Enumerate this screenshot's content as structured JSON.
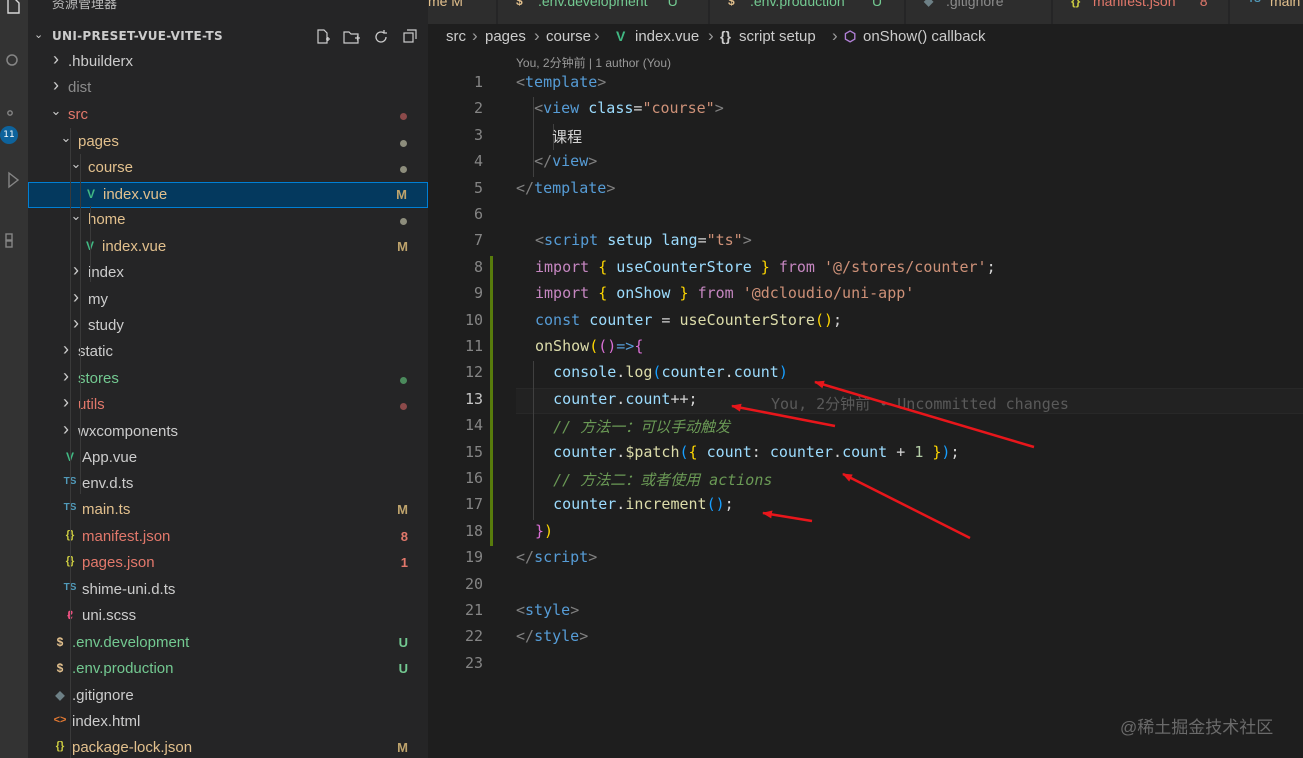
{
  "sidebar": {
    "title": "资源管理器",
    "more": "···",
    "project": "UNI-PRESET-VUE-VITE-TS",
    "items": [
      {
        "label": ".hbuilderx",
        "kind": "folder",
        "color": "#cccccc",
        "badge": "",
        "dot": ""
      },
      {
        "label": "dist",
        "kind": "folder",
        "color": "#8b8b8b",
        "badge": "",
        "dot": ""
      },
      {
        "label": "src",
        "kind": "folder-open",
        "color": "#e2786b",
        "badge": "",
        "dot": "#8c4a4a"
      },
      {
        "label": "pages",
        "kind": "folder-open",
        "color": "#e2c08d",
        "badge": "",
        "dot": "#8d8d7c"
      },
      {
        "label": "course",
        "kind": "folder-open",
        "color": "#e2c08d",
        "badge": "",
        "dot": "#8d8d7c"
      },
      {
        "label": "index.vue",
        "kind": "vue",
        "color": "#e2c08d",
        "badge": "M",
        "badge_color": "#bea36c",
        "dot": ""
      },
      {
        "label": "home",
        "kind": "folder-open",
        "color": "#e2c08d",
        "badge": "",
        "dot": "#8d8d7c"
      },
      {
        "label": "index.vue",
        "kind": "vue",
        "color": "#e2c08d",
        "badge": "M",
        "badge_color": "#bea36c",
        "dot": ""
      },
      {
        "label": "index",
        "kind": "folder",
        "color": "#cccccc",
        "badge": "",
        "dot": ""
      },
      {
        "label": "my",
        "kind": "folder",
        "color": "#cccccc",
        "badge": "",
        "dot": ""
      },
      {
        "label": "study",
        "kind": "folder",
        "color": "#cccccc",
        "badge": "",
        "dot": ""
      },
      {
        "label": "static",
        "kind": "folder",
        "color": "#cccccc",
        "badge": "",
        "dot": ""
      },
      {
        "label": "stores",
        "kind": "folder",
        "color": "#73c991",
        "badge": "",
        "dot": "#4b8a5c"
      },
      {
        "label": "utils",
        "kind": "folder",
        "color": "#e2786b",
        "badge": "",
        "dot": "#8c4a4a"
      },
      {
        "label": "wxcomponents",
        "kind": "folder",
        "color": "#cccccc",
        "badge": "",
        "dot": ""
      },
      {
        "label": "App.vue",
        "kind": "vue",
        "color": "#cccccc",
        "badge": "",
        "dot": ""
      },
      {
        "label": "env.d.ts",
        "kind": "ts",
        "color": "#cccccc",
        "badge": "",
        "dot": ""
      },
      {
        "label": "main.ts",
        "kind": "ts",
        "color": "#e2c08d",
        "badge": "M",
        "badge_color": "#bea36c",
        "dot": ""
      },
      {
        "label": "manifest.json",
        "kind": "json",
        "color": "#e2786b",
        "badge": "8",
        "badge_color": "#e2786b",
        "dot": ""
      },
      {
        "label": "pages.json",
        "kind": "json",
        "color": "#e2786b",
        "badge": "1",
        "badge_color": "#e2786b",
        "dot": ""
      },
      {
        "label": "shime-uni.d.ts",
        "kind": "ts",
        "color": "#cccccc",
        "badge": "",
        "dot": ""
      },
      {
        "label": "uni.scss",
        "kind": "scss",
        "color": "#cccccc",
        "badge": "",
        "dot": ""
      },
      {
        "label": ".env.development",
        "kind": "env",
        "color": "#73c991",
        "badge": "U",
        "badge_color": "#73c991",
        "dot": ""
      },
      {
        "label": ".env.production",
        "kind": "env",
        "color": "#73c991",
        "badge": "U",
        "badge_color": "#73c991",
        "dot": ""
      },
      {
        "label": ".gitignore",
        "kind": "git",
        "color": "#cccccc",
        "badge": "",
        "dot": ""
      },
      {
        "label": "index.html",
        "kind": "html",
        "color": "#cccccc",
        "badge": "",
        "dot": ""
      },
      {
        "label": "package-lock.json",
        "kind": "json",
        "color": "#e2c08d",
        "badge": "M",
        "badge_color": "#bea36c",
        "dot": ""
      }
    ]
  },
  "icons": {
    "vue": "V",
    "ts": "TS",
    "json": "{}",
    "env": "$",
    "html": "<>",
    "git": "◆",
    "scss": "ℓ",
    "chevron_right": "›",
    "chevron_down": "⌄"
  },
  "activity_badge": "11",
  "tabs": [
    {
      "label": "me",
      "badge": "M",
      "icon": "",
      "color": "#e2c08d",
      "badge_color": "#e2c08d"
    },
    {
      "label": ".env.development",
      "badge": "U",
      "icon": "$",
      "icon_color": "#e2c08d",
      "color": "#73c991",
      "badge_color": "#73c991"
    },
    {
      "label": ".env.production",
      "badge": "U",
      "icon": "$",
      "icon_color": "#e2c08d",
      "color": "#73c991",
      "badge_color": "#73c991"
    },
    {
      "label": ".gitignore",
      "badge": "",
      "icon": "◆",
      "icon_color": "#6d8086",
      "color": "#8b8b8b",
      "badge_color": ""
    },
    {
      "label": "manifest.json",
      "badge": "8",
      "icon": "{}",
      "icon_color": "#cbcb41",
      "color": "#e2786b",
      "badge_color": "#e2786b"
    },
    {
      "label": "main",
      "badge": "",
      "icon": "TS",
      "icon_color": "#519aba",
      "color": "#e2c08d",
      "badge_color": ""
    }
  ],
  "breadcrumb": {
    "items": [
      "src",
      "pages",
      "course",
      "index.vue",
      "script setup",
      "onShow() callback"
    ],
    "icons": [
      "",
      "",
      "",
      "V",
      "{}",
      "⬡"
    ]
  },
  "editor": {
    "codelens": "You, 2分钟前 | 1 author (You)",
    "active_line": 13,
    "blame": "You, 2分钟前 • Uncommitted changes",
    "line_numbers": [
      "1",
      "2",
      "3",
      "4",
      "5",
      "6",
      "7",
      "8",
      "9",
      "10",
      "11",
      "12",
      "13",
      "14",
      "15",
      "16",
      "17",
      "18",
      "19",
      "20",
      "21",
      "22",
      "23"
    ],
    "lines": [
      [
        [
          "t-punc",
          "<"
        ],
        [
          "t-tag",
          "template"
        ],
        [
          "t-punc",
          ">"
        ]
      ],
      [
        [
          "t-txt",
          "  "
        ],
        [
          "t-punc",
          "<"
        ],
        [
          "t-tag",
          "view"
        ],
        [
          "t-txt",
          " "
        ],
        [
          "t-attr",
          "class"
        ],
        [
          "t-txt",
          "="
        ],
        [
          "t-str",
          "\"course\""
        ],
        [
          "t-punc",
          ">"
        ]
      ],
      [
        [
          "t-txt",
          "    课程"
        ]
      ],
      [
        [
          "t-txt",
          "  "
        ],
        [
          "t-punc",
          "</"
        ],
        [
          "t-tag",
          "view"
        ],
        [
          "t-punc",
          ">"
        ]
      ],
      [
        [
          "t-punc",
          "</"
        ],
        [
          "t-tag",
          "template"
        ],
        [
          "t-punc",
          ">"
        ]
      ],
      [],
      [
        [
          "t-punc",
          "<"
        ],
        [
          "t-tag",
          "script"
        ],
        [
          "t-txt",
          " "
        ],
        [
          "t-attr",
          "setup"
        ],
        [
          "t-txt",
          " "
        ],
        [
          "t-attr",
          "lang"
        ],
        [
          "t-txt",
          "="
        ],
        [
          "t-str",
          "\"ts\""
        ],
        [
          "t-punc",
          ">"
        ]
      ],
      [
        [
          "t-kw",
          "import"
        ],
        [
          "t-txt",
          " "
        ],
        [
          "t-br1",
          "{"
        ],
        [
          "t-txt",
          " "
        ],
        [
          "t-var",
          "useCounterStore"
        ],
        [
          "t-txt",
          " "
        ],
        [
          "t-br1",
          "}"
        ],
        [
          "t-txt",
          " "
        ],
        [
          "t-kw",
          "from"
        ],
        [
          "t-txt",
          " "
        ],
        [
          "t-str",
          "'@/stores/counter'"
        ],
        [
          "t-txt",
          ";"
        ]
      ],
      [
        [
          "t-kw",
          "import"
        ],
        [
          "t-txt",
          " "
        ],
        [
          "t-br1",
          "{"
        ],
        [
          "t-txt",
          " "
        ],
        [
          "t-var",
          "onShow"
        ],
        [
          "t-txt",
          " "
        ],
        [
          "t-br1",
          "}"
        ],
        [
          "t-txt",
          " "
        ],
        [
          "t-kw",
          "from"
        ],
        [
          "t-txt",
          " "
        ],
        [
          "t-str",
          "'@dcloudio/uni-app'"
        ]
      ],
      [
        [
          "t-kw2",
          "const"
        ],
        [
          "t-txt",
          " "
        ],
        [
          "t-var",
          "counter"
        ],
        [
          "t-txt",
          " = "
        ],
        [
          "t-fn",
          "useCounterStore"
        ],
        [
          "t-br1",
          "()"
        ],
        [
          "t-txt",
          ";"
        ]
      ],
      [
        [
          "t-fn",
          "onShow"
        ],
        [
          "t-br1",
          "("
        ],
        [
          "t-br2",
          "()"
        ],
        [
          "t-kw2",
          "=>"
        ],
        [
          "t-br2",
          "{"
        ]
      ],
      [
        [
          "t-txt",
          "  "
        ],
        [
          "t-var",
          "console"
        ],
        [
          "t-txt",
          "."
        ],
        [
          "t-fn",
          "log"
        ],
        [
          "t-br3",
          "("
        ],
        [
          "t-var",
          "counter"
        ],
        [
          "t-txt",
          "."
        ],
        [
          "t-var",
          "count"
        ],
        [
          "t-br3",
          ")"
        ]
      ],
      [
        [
          "t-txt",
          "  "
        ],
        [
          "t-var",
          "counter"
        ],
        [
          "t-txt",
          "."
        ],
        [
          "t-var",
          "count"
        ],
        [
          "t-txt",
          "++;"
        ]
      ],
      [
        [
          "t-txt",
          "  "
        ],
        [
          "t-cmt",
          "// 方法一：可以手动触发"
        ]
      ],
      [
        [
          "t-txt",
          "  "
        ],
        [
          "t-var",
          "counter"
        ],
        [
          "t-txt",
          "."
        ],
        [
          "t-fn",
          "$patch"
        ],
        [
          "t-br3",
          "("
        ],
        [
          "t-br1",
          "{"
        ],
        [
          "t-txt",
          " "
        ],
        [
          "t-var",
          "count"
        ],
        [
          "t-txt",
          ": "
        ],
        [
          "t-var",
          "counter"
        ],
        [
          "t-txt",
          "."
        ],
        [
          "t-var",
          "count"
        ],
        [
          "t-txt",
          " + "
        ],
        [
          "t-num",
          "1"
        ],
        [
          "t-txt",
          " "
        ],
        [
          "t-br1",
          "}"
        ],
        [
          "t-br3",
          ")"
        ],
        [
          "t-txt",
          ";"
        ]
      ],
      [
        [
          "t-txt",
          "  "
        ],
        [
          "t-cmt",
          "// 方法二：或者使用 actions"
        ]
      ],
      [
        [
          "t-txt",
          "  "
        ],
        [
          "t-var",
          "counter"
        ],
        [
          "t-txt",
          "."
        ],
        [
          "t-fn",
          "increment"
        ],
        [
          "t-br3",
          "()"
        ],
        [
          "t-txt",
          ";"
        ]
      ],
      [
        [
          "t-br2",
          "}"
        ],
        [
          "t-br1",
          ")"
        ]
      ],
      [
        [
          "t-punc",
          "</"
        ],
        [
          "t-tag",
          "script"
        ],
        [
          "t-punc",
          ">"
        ]
      ],
      [],
      [
        [
          "t-punc",
          "<"
        ],
        [
          "t-tag",
          "style"
        ],
        [
          "t-punc",
          ">"
        ]
      ],
      [
        [
          "t-punc",
          "</"
        ],
        [
          "t-tag",
          "style"
        ],
        [
          "t-punc",
          ">"
        ]
      ],
      []
    ]
  },
  "watermark": "@稀土掘金技术社区",
  "colors": {
    "selection": "#04395e",
    "focus": "#007fd4",
    "gutter_added": "#587c0c",
    "arrow": "#e8161b"
  }
}
